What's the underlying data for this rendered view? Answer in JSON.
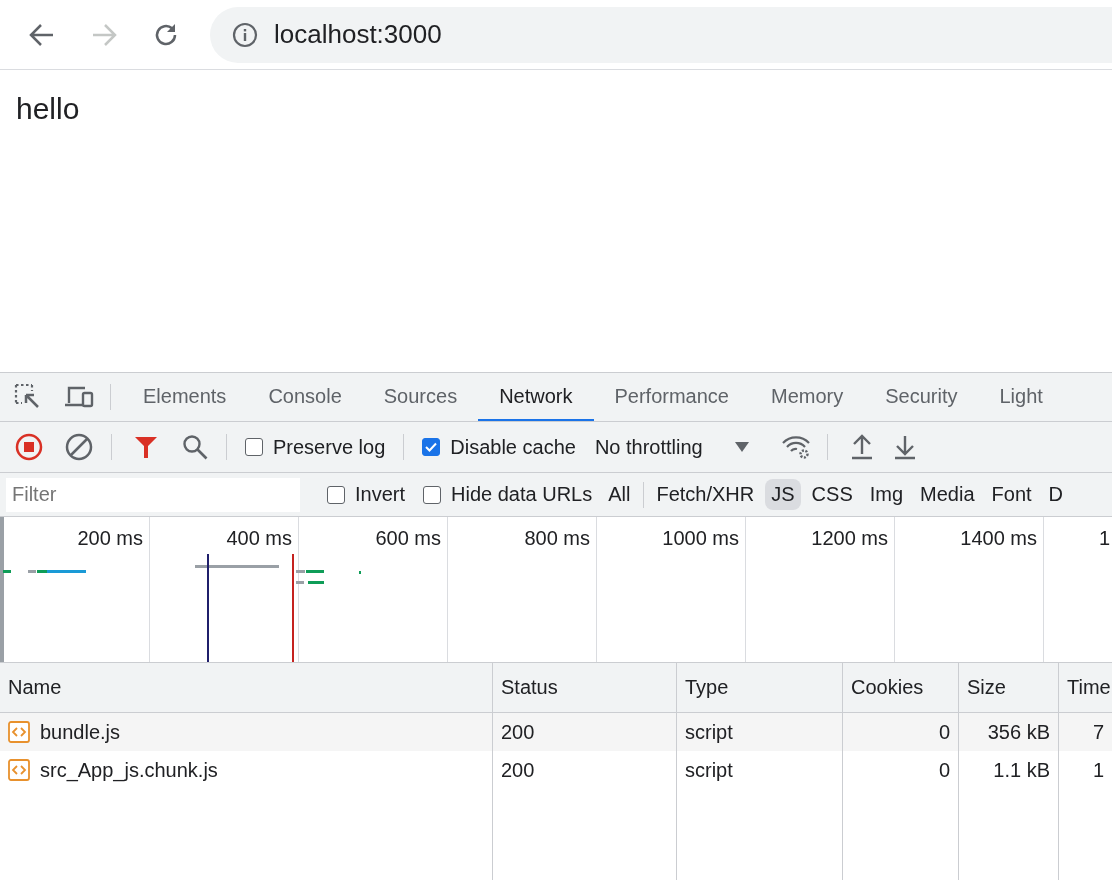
{
  "browser": {
    "url": "localhost:3000",
    "forward_disabled": true
  },
  "page": {
    "text": "hello"
  },
  "devtools": {
    "tabs": [
      {
        "label": "Elements",
        "selected": false
      },
      {
        "label": "Console",
        "selected": false
      },
      {
        "label": "Sources",
        "selected": false
      },
      {
        "label": "Network",
        "selected": true
      },
      {
        "label": "Performance",
        "selected": false
      },
      {
        "label": "Memory",
        "selected": false
      },
      {
        "label": "Security",
        "selected": false
      },
      {
        "label": "Light",
        "selected": false
      }
    ],
    "toolbar": {
      "preserve_log": {
        "label": "Preserve log",
        "checked": false
      },
      "disable_cache": {
        "label": "Disable cache",
        "checked": true
      },
      "throttling": "No throttling"
    },
    "filter": {
      "placeholder": "Filter",
      "invert": {
        "label": "Invert",
        "checked": false
      },
      "hide_data_urls": {
        "label": "Hide data URLs",
        "checked": false
      },
      "types": [
        {
          "label": "All",
          "selected": false
        },
        {
          "label": "Fetch/XHR",
          "selected": false
        },
        {
          "label": "JS",
          "selected": true
        },
        {
          "label": "CSS",
          "selected": false
        },
        {
          "label": "Img",
          "selected": false
        },
        {
          "label": "Media",
          "selected": false
        },
        {
          "label": "Font",
          "selected": false
        },
        {
          "label": "D",
          "selected": false
        }
      ]
    },
    "overview": {
      "ticks": [
        "200 ms",
        "400 ms",
        "600 ms",
        "800 ms",
        "1000 ms",
        "1200 ms",
        "1400 ms",
        "1"
      ]
    },
    "table": {
      "columns": [
        "Name",
        "Status",
        "Type",
        "Cookies",
        "Size",
        "Time"
      ],
      "rows": [
        {
          "cells": [
            "bundle.js",
            "200",
            "script",
            "0",
            "356 kB",
            "7"
          ]
        },
        {
          "cells": [
            "src_App_js.chunk.js",
            "200",
            "script",
            "0",
            "1.1 kB",
            "1"
          ]
        }
      ]
    }
  }
}
